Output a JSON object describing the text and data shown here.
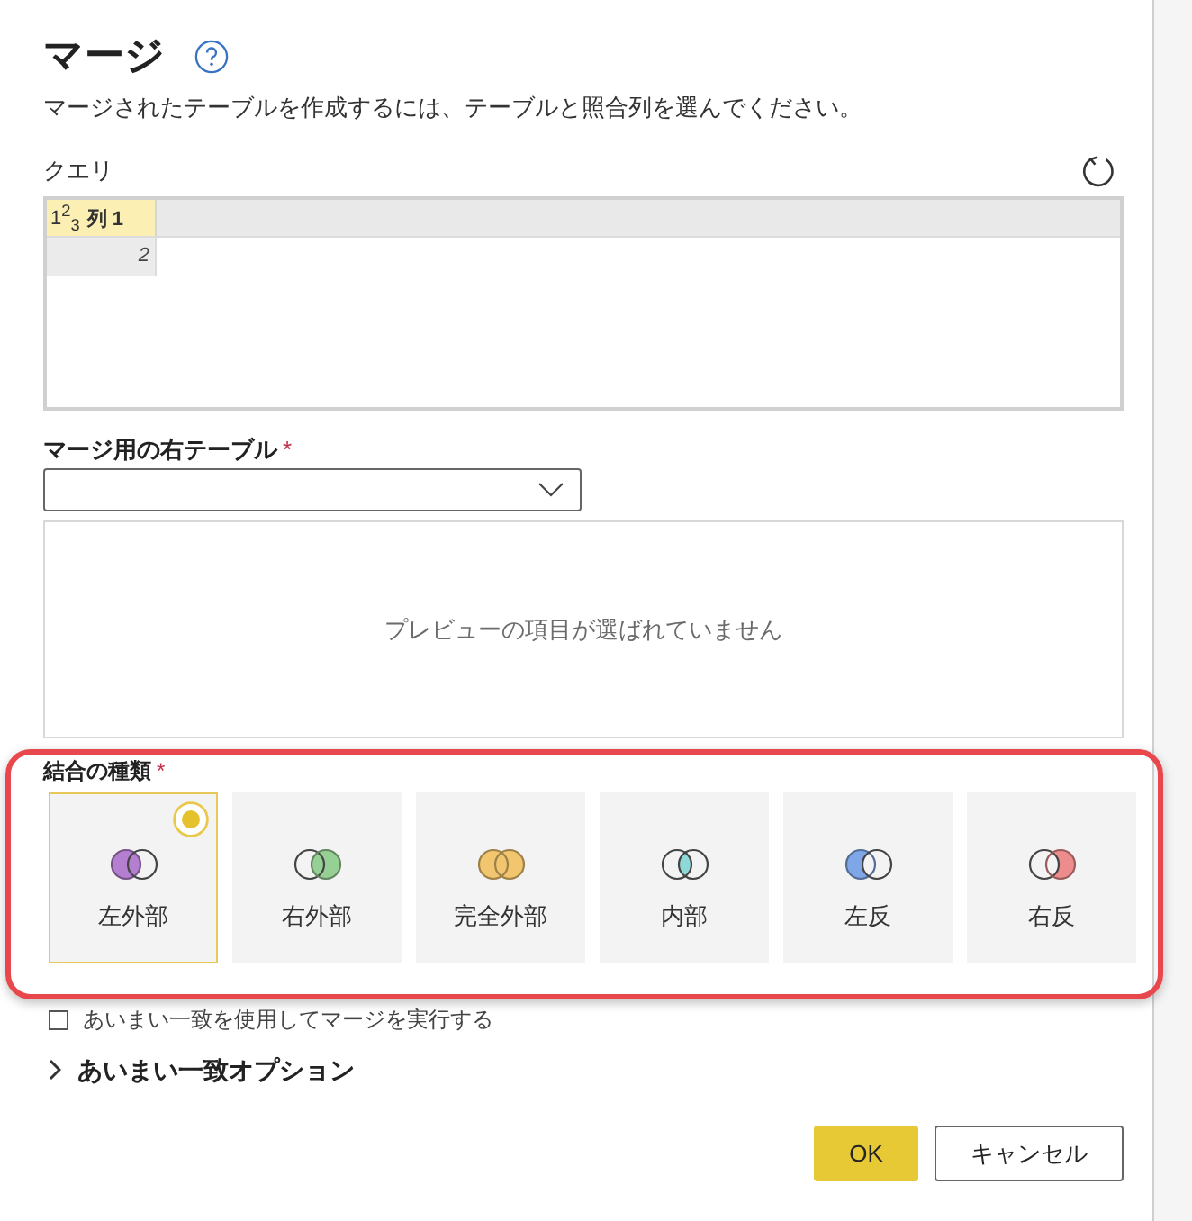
{
  "dialog": {
    "title": "マージ",
    "description": "マージされたテーブルを作成するには、テーブルと照合列を選んでください。"
  },
  "query": {
    "label": "クエリ",
    "columns": [
      {
        "type": "1$^{2}$$_{3}$",
        "name": "列 1",
        "selected": true
      }
    ],
    "rows": [
      {
        "cells": [
          "2"
        ]
      }
    ]
  },
  "right_table": {
    "label": "マージ用の右テーブル",
    "required_mark": "*"
  },
  "preview": {
    "empty_message": "プレビューの項目が選ばれていません"
  },
  "join_kind": {
    "label": "結合の種類",
    "required_mark": "*",
    "options": [
      {
        "label": "左外部",
        "kind": "left_outer",
        "color": "#b47fd0",
        "selected": true
      },
      {
        "label": "右外部",
        "kind": "right_outer",
        "color": "#96d094",
        "selected": false
      },
      {
        "label": "完全外部",
        "kind": "full_outer",
        "color": "#f2c66e",
        "selected": false
      },
      {
        "label": "内部",
        "kind": "inner",
        "color": "#8fd8d8",
        "selected": false
      },
      {
        "label": "左反",
        "kind": "left_anti",
        "color": "#7fa7e8",
        "selected": false
      },
      {
        "label": "右反",
        "kind": "right_anti",
        "color": "#ec8c8c",
        "selected": false
      }
    ]
  },
  "fuzzy_match": {
    "label": "あいまい一致を使用してマージを実行する",
    "checked": false
  },
  "fuzzy_options": {
    "label": "あいまい一致オプション",
    "expanded": false
  },
  "buttons": [
    {
      "label": "OK",
      "kind": "primary"
    },
    {
      "label": "キャンセル",
      "kind": "secondary"
    }
  ]
}
